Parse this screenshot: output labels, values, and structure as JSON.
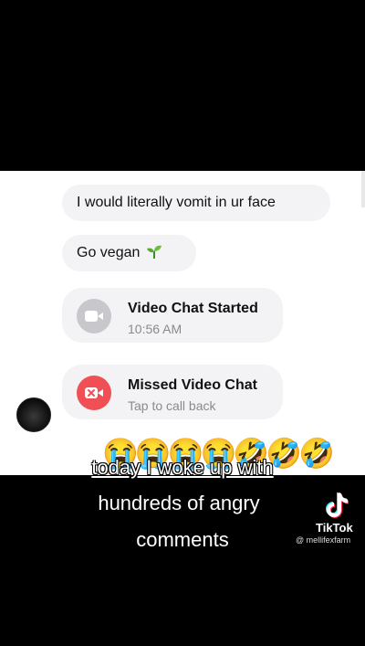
{
  "messages": [
    {
      "text": "I would literally vomit in ur face"
    },
    {
      "text": "Go vegan",
      "emoji": "🌱"
    }
  ],
  "calls": [
    {
      "title": "Video Chat Started",
      "subtitle": "10:56 AM",
      "icon": "video-camera-icon",
      "color": "#c8c8cc"
    },
    {
      "title": "Missed Video Chat",
      "subtitle": "Tap to call back",
      "icon": "missed-video-icon",
      "color": "#f05055"
    }
  ],
  "emojis": "😭😭😭😭🤣🤣🤣",
  "caption": {
    "line1": "today I woke up with",
    "line2": "hundreds of angry",
    "line3": "comments"
  },
  "watermark": {
    "brand": "TikTok",
    "handle": "@ mellifexfarm"
  }
}
